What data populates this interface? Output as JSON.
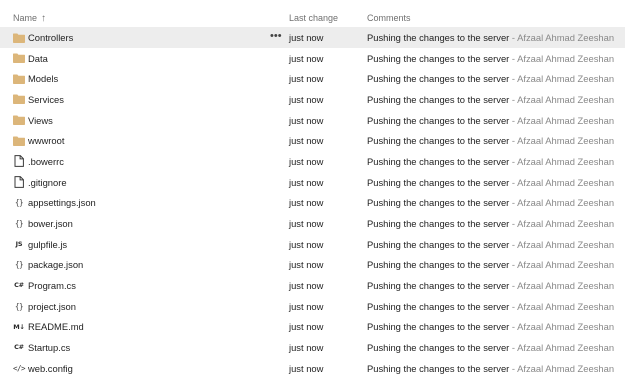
{
  "header": {
    "name": "Name",
    "sort_arrow": "↑",
    "last_change": "Last change",
    "comments": "Comments"
  },
  "row_more": "•••",
  "rows": [
    {
      "icon": "folder",
      "name": "Controllers",
      "change": "just now",
      "message": "Pushing the changes to the server",
      "separator": " - ",
      "author": "Afzaal Ahmad Zeeshan"
    },
    {
      "icon": "folder",
      "name": "Data",
      "change": "just now",
      "message": "Pushing the changes to the server",
      "separator": " - ",
      "author": "Afzaal Ahmad Zeeshan"
    },
    {
      "icon": "folder",
      "name": "Models",
      "change": "just now",
      "message": "Pushing the changes to the server",
      "separator": " - ",
      "author": "Afzaal Ahmad Zeeshan"
    },
    {
      "icon": "folder",
      "name": "Services",
      "change": "just now",
      "message": "Pushing the changes to the server",
      "separator": " - ",
      "author": "Afzaal Ahmad Zeeshan"
    },
    {
      "icon": "folder",
      "name": "Views",
      "change": "just now",
      "message": "Pushing the changes to the server",
      "separator": " - ",
      "author": "Afzaal Ahmad Zeeshan"
    },
    {
      "icon": "folder",
      "name": "wwwroot",
      "change": "just now",
      "message": "Pushing the changes to the server",
      "separator": " - ",
      "author": "Afzaal Ahmad Zeeshan"
    },
    {
      "icon": "file",
      "name": ".bowerrc",
      "change": "just now",
      "message": "Pushing the changes to the server",
      "separator": " - ",
      "author": "Afzaal Ahmad Zeeshan"
    },
    {
      "icon": "file",
      "name": ".gitignore",
      "change": "just now",
      "message": "Pushing the changes to the server",
      "separator": " - ",
      "author": "Afzaal Ahmad Zeeshan"
    },
    {
      "icon": "json",
      "glyph": "{}",
      "name": "appsettings.json",
      "change": "just now",
      "message": "Pushing the changes to the server",
      "separator": " - ",
      "author": "Afzaal Ahmad Zeeshan"
    },
    {
      "icon": "json",
      "glyph": "{}",
      "name": "bower.json",
      "change": "just now",
      "message": "Pushing the changes to the server",
      "separator": " - ",
      "author": "Afzaal Ahmad Zeeshan"
    },
    {
      "icon": "js",
      "glyph": "JS",
      "name": "gulpfile.js",
      "change": "just now",
      "message": "Pushing the changes to the server",
      "separator": " - ",
      "author": "Afzaal Ahmad Zeeshan"
    },
    {
      "icon": "json",
      "glyph": "{}",
      "name": "package.json",
      "change": "just now",
      "message": "Pushing the changes to the server",
      "separator": " - ",
      "author": "Afzaal Ahmad Zeeshan"
    },
    {
      "icon": "csharp",
      "glyph": "C#",
      "name": "Program.cs",
      "change": "just now",
      "message": "Pushing the changes to the server",
      "separator": " - ",
      "author": "Afzaal Ahmad Zeeshan"
    },
    {
      "icon": "json",
      "glyph": "{}",
      "name": "project.json",
      "change": "just now",
      "message": "Pushing the changes to the server",
      "separator": " - ",
      "author": "Afzaal Ahmad Zeeshan"
    },
    {
      "icon": "markdown",
      "glyph": "M↓",
      "name": "README.md",
      "change": "just now",
      "message": "Pushing the changes to the server",
      "separator": " - ",
      "author": "Afzaal Ahmad Zeeshan"
    },
    {
      "icon": "csharp",
      "glyph": "C#",
      "name": "Startup.cs",
      "change": "just now",
      "message": "Pushing the changes to the server",
      "separator": " - ",
      "author": "Afzaal Ahmad Zeeshan"
    },
    {
      "icon": "xml",
      "glyph": "</>",
      "name": "web.config",
      "change": "just now",
      "message": "Pushing the changes to the server",
      "separator": " - ",
      "author": "Afzaal Ahmad Zeeshan"
    }
  ],
  "colors": {
    "folder": "#dcb67a",
    "selected_row": "#ededed",
    "author": "#888888",
    "text": "#1f1f1f",
    "header_text": "#707070"
  }
}
